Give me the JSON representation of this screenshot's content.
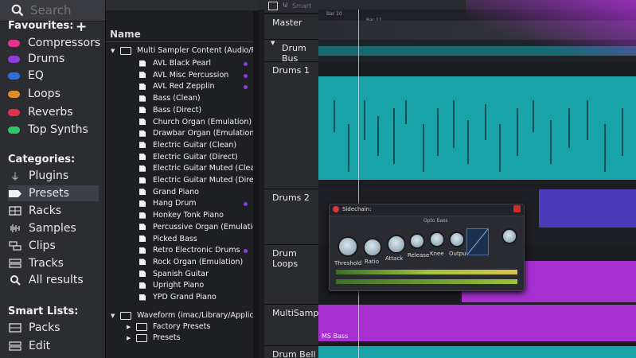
{
  "search": {
    "placeholder": "Search"
  },
  "favourites": {
    "title": "Favourites:",
    "add": "+",
    "items": [
      {
        "label": "Compressors",
        "color": "#e0348d"
      },
      {
        "label": "Drums",
        "color": "#8b3fd6"
      },
      {
        "label": "EQ",
        "color": "#2d6fe0"
      },
      {
        "label": "Loops",
        "color": "#e08a2e"
      },
      {
        "label": "Reverbs",
        "color": "#e0304a"
      },
      {
        "label": "Top Synths",
        "color": "#2fc56a"
      }
    ]
  },
  "categories": {
    "title": "Categories:",
    "items": [
      {
        "label": "Plugins",
        "icon": "plug-icon"
      },
      {
        "label": "Presets",
        "icon": "tag-icon",
        "selected": true
      },
      {
        "label": "Racks",
        "icon": "rack-icon"
      },
      {
        "label": "Samples",
        "icon": "waveform-icon"
      },
      {
        "label": "Clips",
        "icon": "clips-icon"
      },
      {
        "label": "Tracks",
        "icon": "tracks-icon"
      },
      {
        "label": "All results",
        "icon": "search-icon"
      }
    ]
  },
  "smart_lists": {
    "title": "Smart Lists:",
    "items": [
      {
        "label": "Packs"
      },
      {
        "label": "Edit"
      }
    ]
  },
  "tree": {
    "header": "Name",
    "root_folder": "Multi Sampler Content (Audio/P...",
    "presets": [
      "AVL Black Pearl",
      "AVL Misc Percussion",
      "AVL Red Zepplin",
      "Bass (Clean)",
      "Bass (Direct)",
      "Church Organ (Emulation)",
      "Drawbar Organ (Emulation)",
      "Electric Guitar (Clean)",
      "Electric Guitar (Direct)",
      "Electric Guitar Muted (Clean)",
      "Electric Guitar Muted (Direct)",
      "Grand Piano",
      "Hang Drum",
      "Honkey Tonk Piano",
      "Percussive Organ (Emulation)",
      "Picked Bass",
      "Retro Electronic Drums",
      "Rock Organ (Emulation)",
      "Spanish Guitar",
      "Upright Piano",
      "YPD Grand Piano"
    ],
    "waveform_folder": "Waveform (imac/Library/Applica...",
    "sub_folders": [
      "Factory Presets",
      "Presets"
    ]
  },
  "topbar": {
    "smart": "Smart",
    "bar10": "Bar 10",
    "bar11": "Bar 11"
  },
  "tracks": [
    {
      "label": "Master"
    },
    {
      "label": "Drum Bus"
    },
    {
      "label": "Drums 1"
    },
    {
      "label": "Drums 2"
    },
    {
      "label": "Drum Loops"
    },
    {
      "label": "MultiSampler"
    },
    {
      "label": "Drum Bell"
    }
  ],
  "clip_label": "MS Bass",
  "plugin": {
    "sidechain": "Sidechain:",
    "preset": "Opto Bass",
    "knobs": [
      "Threshold",
      "Ratio",
      "Attack",
      "Release",
      "Knee",
      "Output"
    ]
  },
  "colors": {
    "teal": "#17a3a8",
    "purple": "#a72fd0"
  }
}
